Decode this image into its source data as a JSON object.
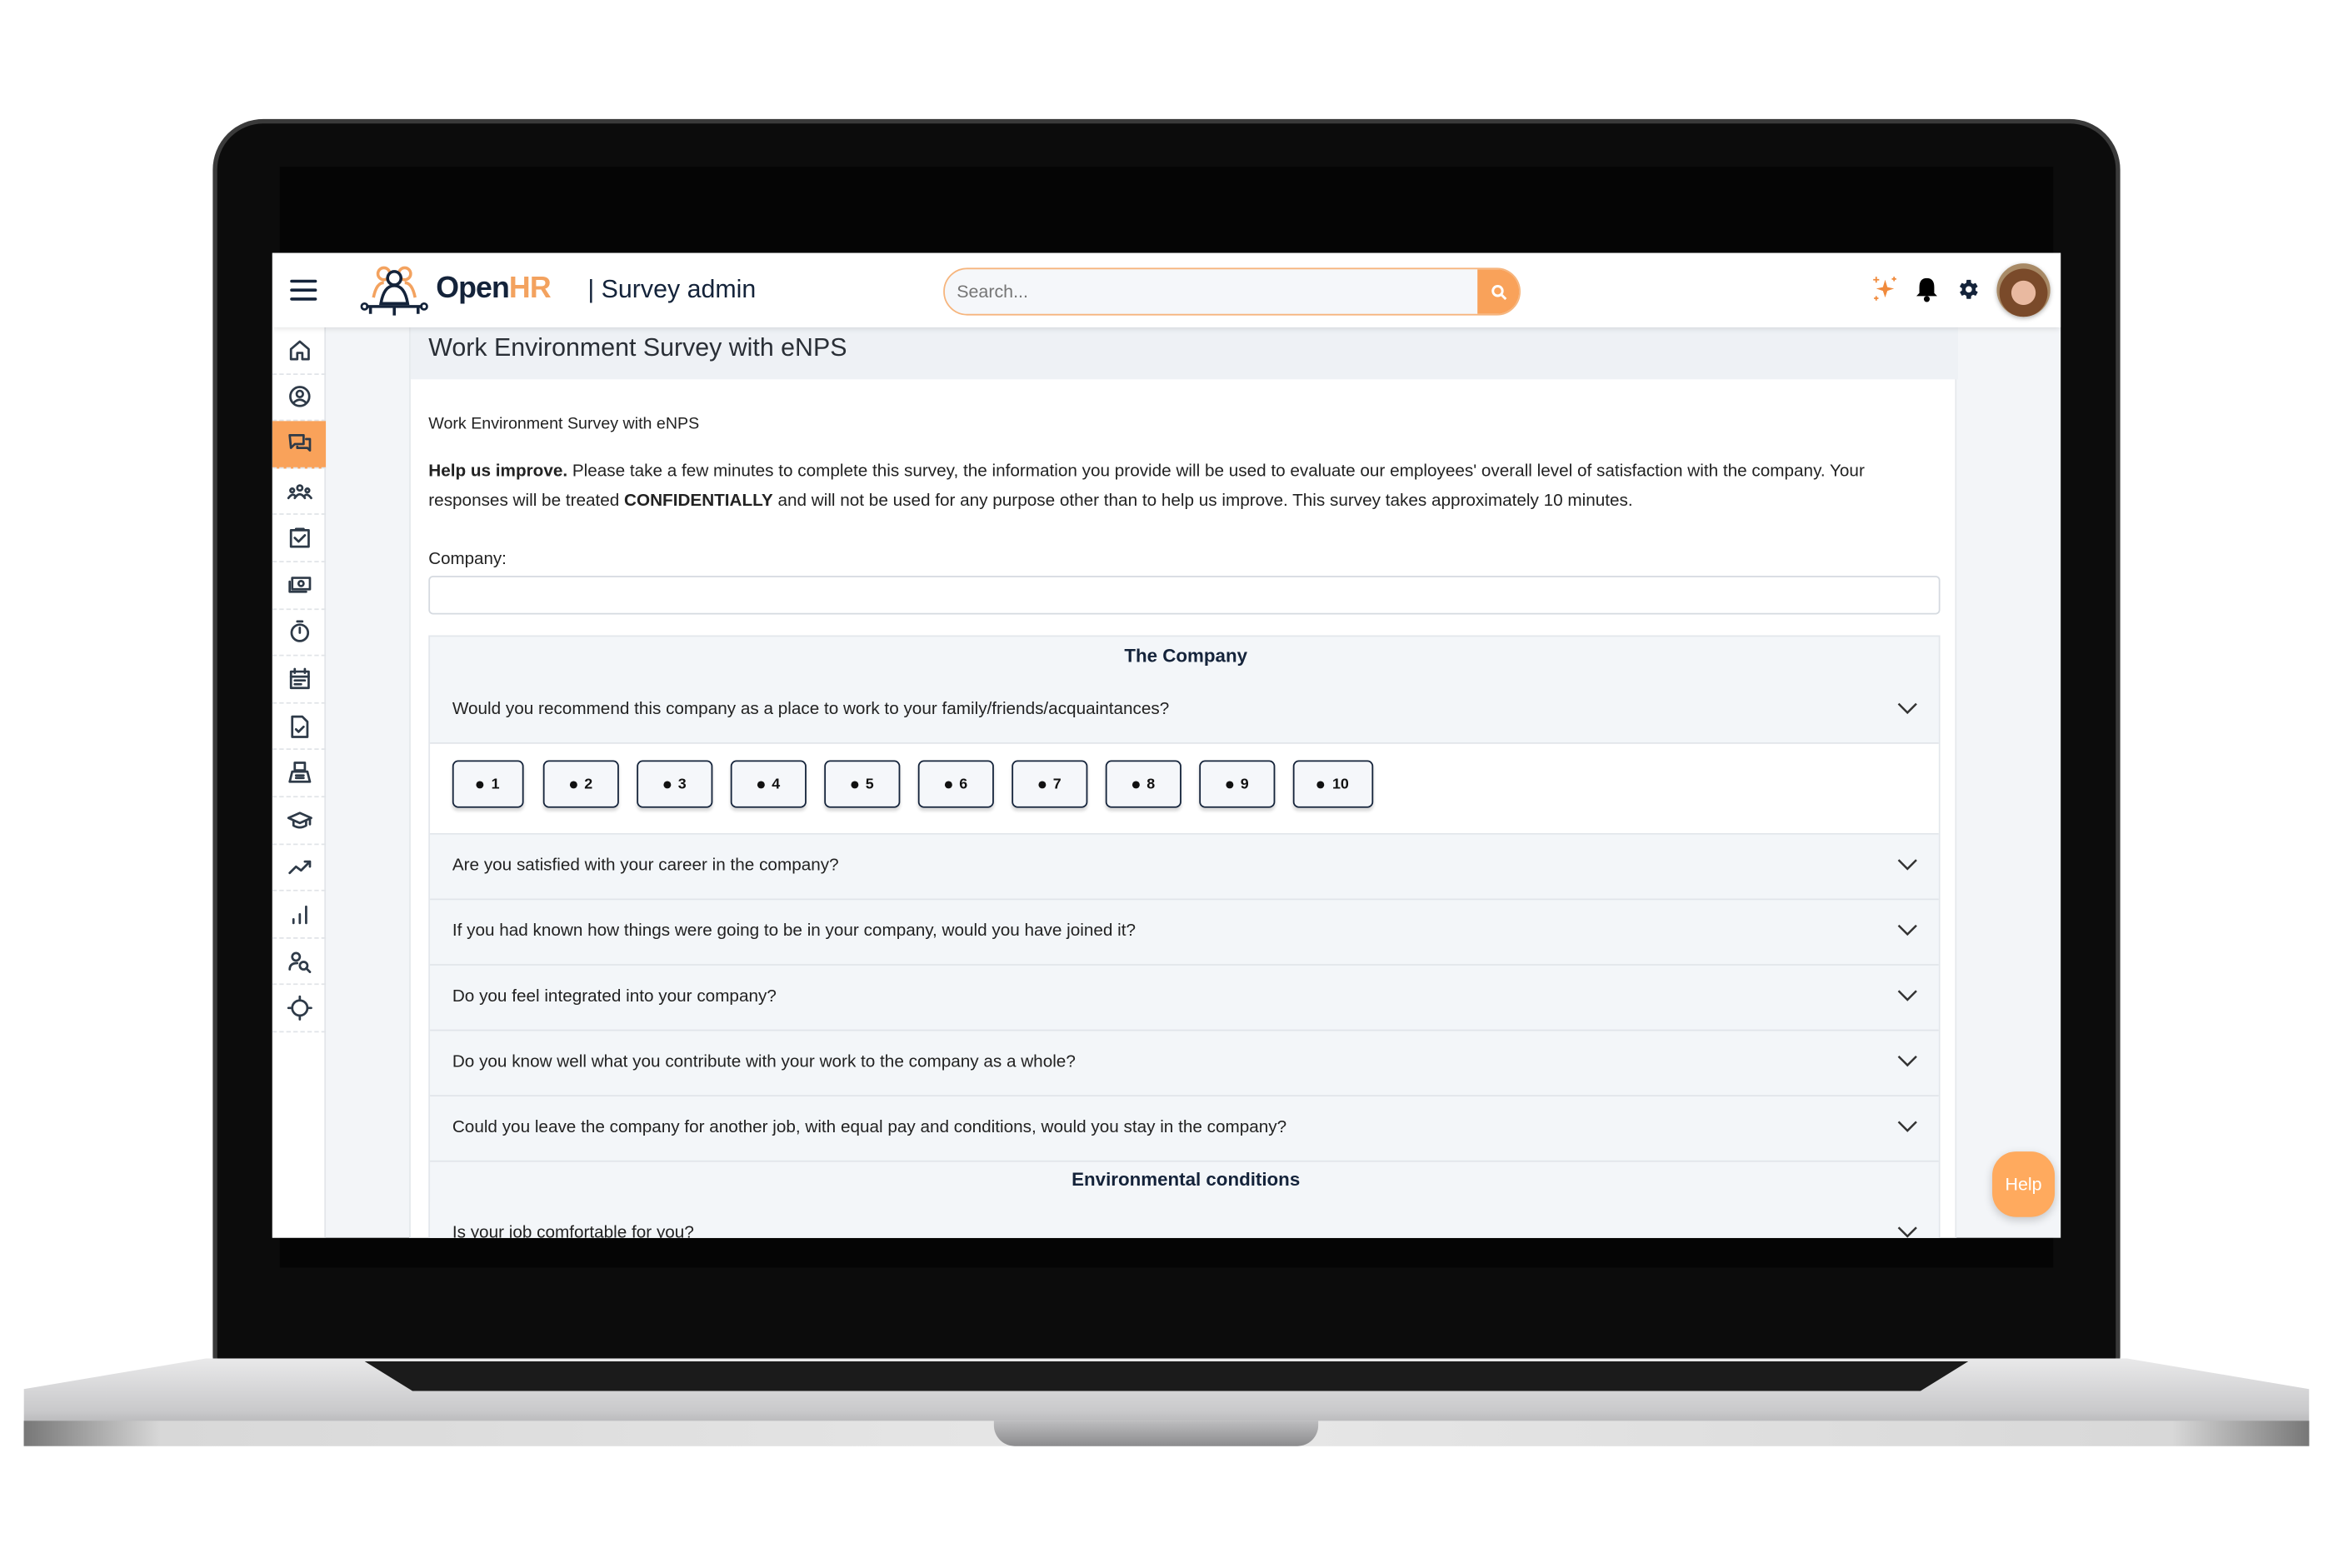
{
  "header": {
    "logo_text": "Open",
    "logo_accent": "HR",
    "app_name": "| Survey admin",
    "search_placeholder": "Search...",
    "icons": [
      "menu-icon",
      "search-icon",
      "sparkle-icon",
      "bell-icon",
      "gear-icon",
      "avatar"
    ]
  },
  "sidebar": {
    "items": [
      {
        "icon": "home-icon"
      },
      {
        "icon": "user-circle-icon"
      },
      {
        "icon": "chat-icon",
        "active": true
      },
      {
        "icon": "team-icon"
      },
      {
        "icon": "clipboard-check-icon"
      },
      {
        "icon": "money-icon"
      },
      {
        "icon": "stopwatch-icon"
      },
      {
        "icon": "calendar-icon"
      },
      {
        "icon": "document-check-icon"
      },
      {
        "icon": "fax-icon"
      },
      {
        "icon": "graduation-cap-icon"
      },
      {
        "icon": "trending-up-icon"
      },
      {
        "icon": "bar-chart-icon"
      },
      {
        "icon": "user-search-icon"
      },
      {
        "icon": "crosshair-icon"
      }
    ]
  },
  "page": {
    "title": "Work Environment Survey with eNPS",
    "subtitle": "Work Environment Survey with eNPS",
    "intro_bold": "Help us improve.",
    "intro_1": " Please take a few minutes to complete this survey, the information you provide will be used to evaluate our employees' overall level of satisfaction with the company. Your responses will be treated ",
    "intro_bold2": "CONFIDENTIALLY",
    "intro_2": " and will not be used for any purpose other than to help us improve. This survey takes approximately 10 minutes.",
    "company_label": "Company:",
    "company_value": ""
  },
  "sections": [
    {
      "title": "The Company",
      "questions": [
        "Would you recommend this company as a place to work to your family/friends/acquaintances?",
        "Are you satisfied with your career in the company?",
        "If you had known how things were going to be in your company, would you have joined it?",
        "Do you feel integrated into your company?",
        "Do you know well what you contribute with your work to the company as a whole?",
        "Could you leave the company for another job, with equal pay and conditions, would you stay in the company?"
      ]
    },
    {
      "title": "Environmental conditions",
      "questions": [
        "Is your job comfortable for you?"
      ]
    }
  ],
  "rating_options": [
    "1",
    "2",
    "3",
    "4",
    "5",
    "6",
    "7",
    "8",
    "9",
    "10"
  ],
  "help_label": "Help",
  "colors": {
    "accent": "#f9a25a",
    "navy": "#14233a",
    "help": "#ffaa5e"
  }
}
